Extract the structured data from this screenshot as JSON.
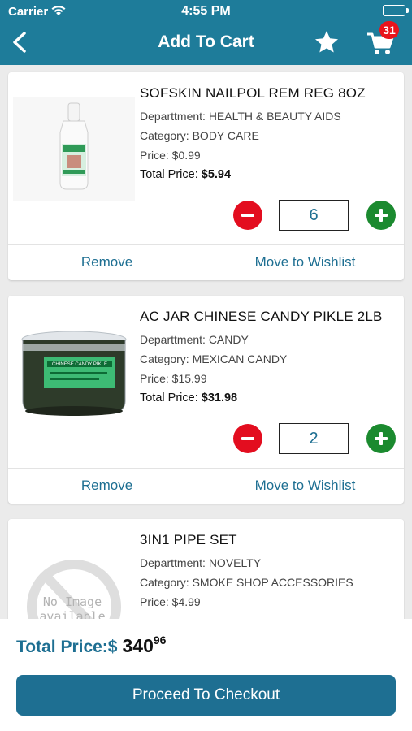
{
  "status_bar": {
    "carrier": "Carrier",
    "time": "4:55 PM"
  },
  "nav": {
    "title": "Add To Cart",
    "cart_count": "31",
    "back_icon": "chevron-left-icon",
    "wishlist_icon": "star-icon",
    "cart_icon": "cart-icon"
  },
  "colors": {
    "header": "#1e7c9a",
    "accent": "#1e6f92",
    "minus": "#e30d1f",
    "plus": "#1b8a2f",
    "badge": "#e8141c"
  },
  "items": [
    {
      "name": "SOFSKIN NAILPOL REM REG 8OZ",
      "department": "Departtment: HEALTH & BEAUTY AIDS",
      "category": "Category: BODY CARE",
      "price": "Price: $0.99",
      "total_label": "Total Price:",
      "total_value": "$5.94",
      "quantity": "6",
      "remove_label": "Remove",
      "wishlist_label": "Move to Wishlist"
    },
    {
      "name": "AC JAR CHINESE CANDY PIKLE 2LB",
      "department": "Departtment: CANDY",
      "category": "Category: MEXICAN CANDY",
      "price": "Price: $15.99",
      "total_label": "Total Price:",
      "total_value": "$31.98",
      "quantity": "2",
      "remove_label": "Remove",
      "wishlist_label": "Move to Wishlist",
      "jar_label": "CHINESE CANDY PIKLE"
    },
    {
      "name": "3IN1 PIPE SET",
      "department": "Departtment: NOVELTY",
      "category": "Category: SMOKE SHOP ACCESSORIES",
      "price": "Price: $4.99",
      "no_image_line1": "No Image",
      "no_image_line2": "available"
    }
  ],
  "footer": {
    "total_label": "Total Price:$",
    "total_whole": "340",
    "total_cents": "96",
    "checkout_label": "Proceed To Checkout"
  }
}
